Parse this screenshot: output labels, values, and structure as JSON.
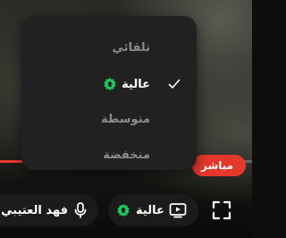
{
  "player": {
    "live_label": "مباشر",
    "progress": 0.12,
    "accent_color": "#ef3b2d",
    "hd_badge_color": "#22c55e"
  },
  "quality_menu": {
    "selected_index": 1,
    "items": [
      {
        "label": "تلقائي",
        "hd": false
      },
      {
        "label": "عالية",
        "hd": true
      },
      {
        "label": "متوسطة",
        "hd": false
      },
      {
        "label": "منخفضة",
        "hd": false
      }
    ]
  },
  "toolbar": {
    "user_name": "فهد العتيبي",
    "mic_icon": "microphone-icon",
    "quality_label": "عالية",
    "quality_icon": "screen-icon",
    "fullscreen_icon": "fullscreen-icon"
  }
}
